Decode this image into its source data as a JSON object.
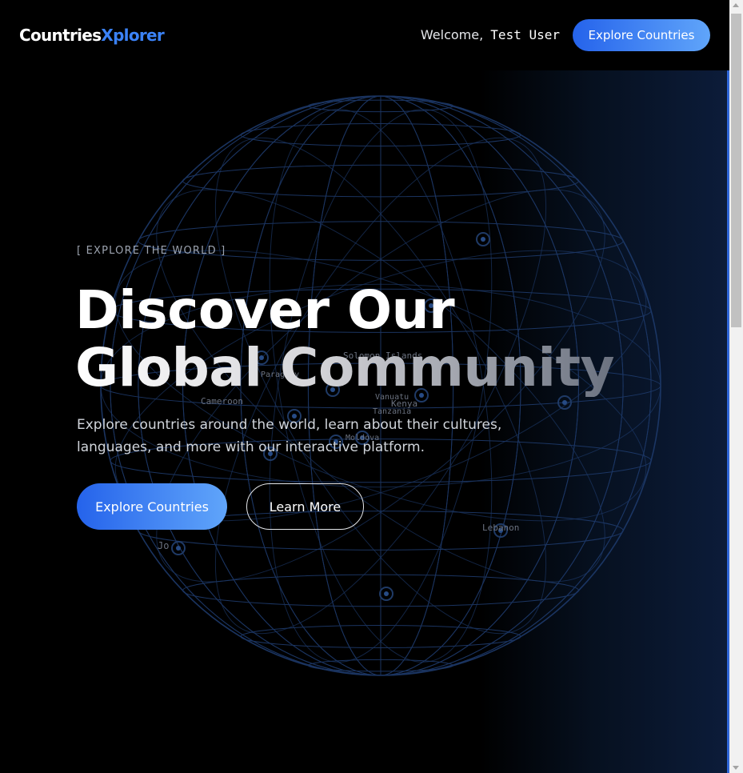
{
  "nav": {
    "logo_part1": "Countries",
    "logo_part2": "Xplorer",
    "welcome_prefix": "Welcome,",
    "user_name": "Test User",
    "cta_label": "Explore Countries"
  },
  "hero": {
    "eyebrow": "[ EXPLORE THE WORLD ]",
    "title_line1": "Discover Our",
    "title_line2": "Global Community",
    "subtitle": "Explore countries around the world, learn about their cultures, languages, and more with our interactive platform.",
    "primary_cta": "Explore Countries",
    "secondary_cta": "Learn More"
  },
  "globe": {
    "labels": [
      "Solomon Islands",
      "Paraguay",
      "Cameroon",
      "Vanuatu",
      "Kenya",
      "Tanzania",
      "Moldova",
      "Lebanon",
      "Jo"
    ]
  },
  "colors": {
    "accent": "#3b82f6",
    "button_gradient_start": "#2563eb",
    "button_gradient_end": "#60a5fa",
    "globe_line": "#1e3a6b"
  }
}
